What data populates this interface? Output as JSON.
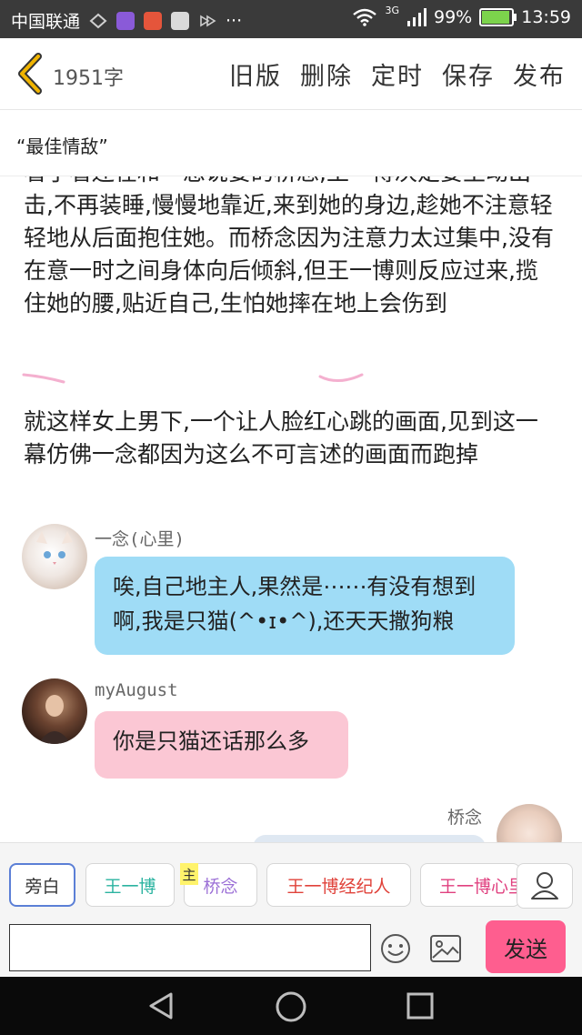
{
  "status_bar": {
    "carrier": "中国联通",
    "signal_type": "3G",
    "battery": "99%",
    "battery_level": 0.99,
    "time": "13:59",
    "dots": "···"
  },
  "header": {
    "back_icon": "chevron-left-icon",
    "word_count": "1951字",
    "actions": {
      "old_version": "旧版",
      "delete": "删除",
      "schedule": "定时",
      "save": "保存",
      "publish": "发布"
    }
  },
  "title": "“最佳情敌”",
  "story": {
    "paragraph1": "看了看还在和一息说要的桥念,王一博决定要主动出击,不再装睡,慢慢地靠近,来到她的身边,趁她不注意轻轻地从后面抱住她。而桥念因为注意力太过集中,没有在意一时之间身体向后倾斜,但王一博则反应过来,揽住她的腰,贴近自己,生怕她摔在地上会伤到",
    "paragraph2": "就这样女上男下,一个让人脸红心跳的画面,见到这一幕仿佛一念都因为这么不可言述的画面而跑掉"
  },
  "messages": [
    {
      "name": "一念(心里)",
      "text": "唉,自己地主人,果然是⋯⋯有没有想到啊,我是只猫(^•ɪ•^),还天天撒狗粮",
      "color": "#9fdcf6"
    },
    {
      "name": "myAugust",
      "text": "你是只猫还话那么多",
      "color": "#fbc7d4"
    },
    {
      "name": "桥念"
    }
  ],
  "roles": {
    "narrator": "旁白",
    "r1": "王一博",
    "host_badge": "主",
    "r2": "桥念",
    "r3": "王一博经纪人",
    "r4": "王一博心里"
  },
  "role_colors": {
    "r1": "#2bb3a0",
    "r2": "#9b6fd6",
    "r3": "#e0423a",
    "r4": "#e0407f"
  },
  "input": {
    "placeholder": "",
    "send_label": "发送"
  },
  "colors": {
    "send": "#fe5e8f",
    "accent_back": "#f0b400"
  }
}
